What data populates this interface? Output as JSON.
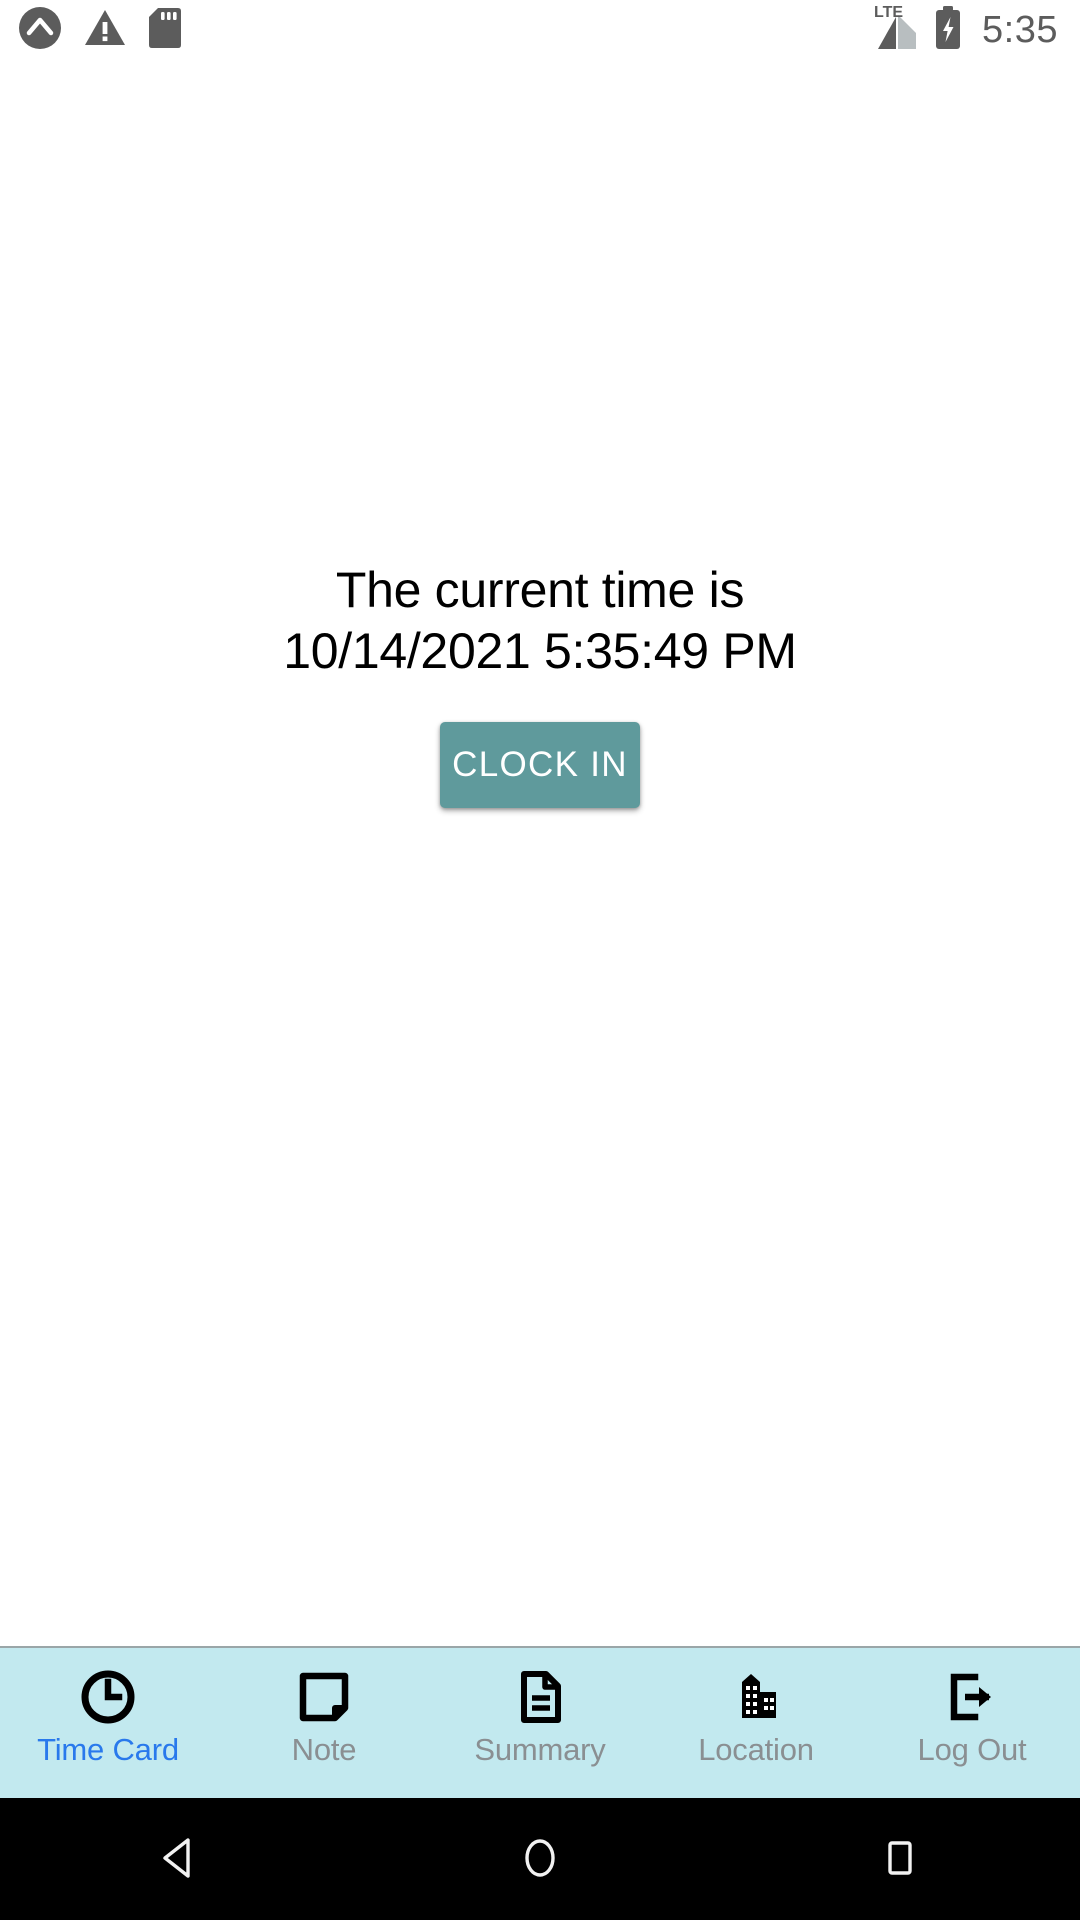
{
  "status_bar": {
    "left_icons": [
      {
        "name": "app-circle-caret-icon",
        "glyph": "caret-circle"
      },
      {
        "name": "warning-triangle-icon",
        "glyph": "warning"
      },
      {
        "name": "sd-card-icon",
        "glyph": "sd-card"
      }
    ],
    "network_label": "LTE",
    "signal_icon": "signal-bars-icon",
    "battery_icon": "battery-charging-icon",
    "clock": "5:35",
    "icon_color": "#5c5c5c"
  },
  "main": {
    "message_line_1": "The current time is",
    "message_line_2": "10/14/2021 5:35:49 PM",
    "clock_in_label": "CLOCK IN",
    "clock_in_color": "#5f9a9c"
  },
  "tab_bar": {
    "background": "#c2e9ef",
    "active_color": "#2979ec",
    "inactive_color": "#8a8f92",
    "items": [
      {
        "label": "Time Card",
        "icon": "clock-icon",
        "active": true
      },
      {
        "label": "Note",
        "icon": "note-page-icon",
        "active": false
      },
      {
        "label": "Summary",
        "icon": "document-lines-icon",
        "active": false
      },
      {
        "label": "Location",
        "icon": "building-icon",
        "active": false
      },
      {
        "label": "Log Out",
        "icon": "logout-arrow-icon",
        "active": false
      }
    ]
  },
  "nav_bar": {
    "buttons": [
      {
        "label": "Back",
        "icon": "back-triangle-icon"
      },
      {
        "label": "Home",
        "icon": "home-circle-icon"
      },
      {
        "label": "Recents",
        "icon": "recents-square-icon"
      }
    ]
  }
}
